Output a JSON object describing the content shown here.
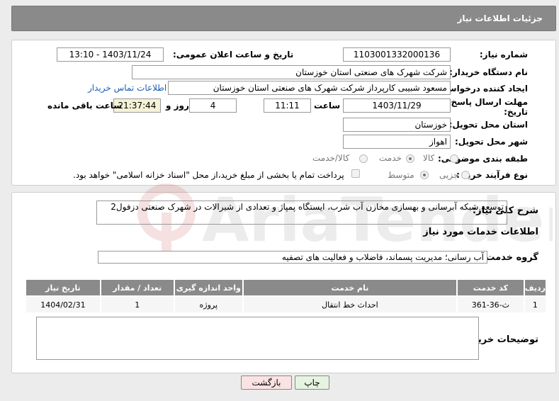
{
  "header": {
    "title": "جزئیات اطلاعات نیاز"
  },
  "form": {
    "need_number_label": "شماره نیاز:",
    "need_number": "1103001332000136",
    "announce_label": "تاریخ و ساعت اعلان عمومی:",
    "announce_value": "1403/11/24 - 13:10",
    "buyer_org_label": "نام دستگاه خریدار:",
    "buyer_org": "شرکت شهرک های صنعتی استان خوزستان",
    "creator_label": "ایجاد کننده درخواست:",
    "creator": "مسعود شبیبی کارپرداز شرکت شهرک های صنعتی استان خوزستان",
    "contact_link": "اطلاعات تماس خریدار",
    "deadline_label_1": "مهلت ارسال پاسخ: تا",
    "deadline_label_2": "تاریخ:",
    "deadline_date": "1403/11/29",
    "time_label": "ساعت",
    "deadline_time": "11:11",
    "days_value": "4",
    "days_label": "روز و",
    "remaining_time": "21:37:44",
    "remaining_label": "ساعت باقی مانده",
    "province_label": "استان محل تحویل:",
    "province": "خوزستان",
    "city_label": "شهر محل تحویل:",
    "city": "اهواز",
    "category_label": "طبقه بندی موضوعی:",
    "category_options": [
      "کالا",
      "خدمت",
      "کالا/خدمت"
    ],
    "category_selected": "خدمت",
    "process_label": "نوع فرآیند خرید :",
    "process_options": [
      "جزیی",
      "متوسط"
    ],
    "process_selected": "متوسط",
    "payment_note": "پرداخت تمام یا بخشی از مبلغ خرید،از محل \"اسناد خزانه اسلامی\" خواهد بود."
  },
  "description": {
    "label": "شرح کلی نیاز:",
    "text": "توسعه شبکه آبرسانی و بهسازی مخازن آب شرب، ایستگاه پمپاژ و تعدادی از شیرالات در شهرک صنعتی دزفول2"
  },
  "services": {
    "section_title": "اطلاعات خدمات مورد نیاز",
    "group_label": "گروه خدمت:",
    "group_value": "آب رسانی؛ مدیریت پسماند، فاضلاب و فعالیت های تصفیه",
    "columns": [
      "ردیف",
      "کد خدمت",
      "نام خدمت",
      "واحد اندازه گیری",
      "تعداد / مقدار",
      "تاریخ نیاز"
    ],
    "rows": [
      [
        "1",
        "ث-36-361",
        "احداث خط انتقال",
        "پروژه",
        "1",
        "1404/02/31"
      ]
    ]
  },
  "buyer_notes": {
    "label": "توضیحات خریدار:",
    "value": ""
  },
  "buttons": {
    "print": "چاپ",
    "back": "بازگشت"
  },
  "watermark": {
    "text": "AriaTender.neT"
  },
  "colors": {
    "header_bg": "#8a8a8a",
    "link": "#1a5fb4",
    "remaining_bg": "#f5f2d5",
    "back_bg": "#fbe3e3",
    "print_bg": "#e6f3e0"
  }
}
